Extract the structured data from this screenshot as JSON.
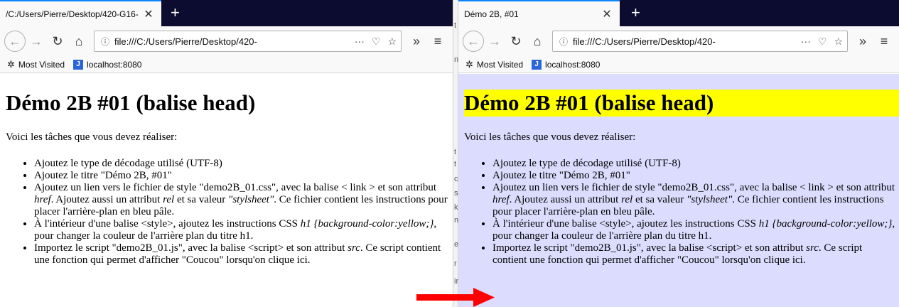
{
  "left_window": {
    "tab": {
      "title": "/C:/Users/Pierre/Desktop/420-G16-",
      "close_label": "✕",
      "new_tab_label": "+"
    },
    "url": "file:///C:/Users/Pierre/Desktop/420-",
    "bookmarks": [
      {
        "label": "Most Visited",
        "icon": "gear-icon"
      },
      {
        "label": "localhost:8080",
        "icon": "jetbrains-icon"
      }
    ],
    "page": {
      "heading": "Démo 2B #01 (balise head)",
      "intro": "Voici les tâches que vous devez réaliser:",
      "items": [
        "Ajoutez le type de décodage utilisé (UTF-8)",
        "Ajoutez le titre \"Démo 2B, #01\"",
        "Ajoutez un lien vers le fichier de style \"demo2B_01.css\", avec la balise < link > et son attribut href. Ajoutez aussi un attribut rel et sa valeur \"stylsheet\". Ce fichier contient les instructions pour placer l'arrière-plan en bleu pâle.",
        "À l'intérieur d'une balise <style>, ajoutez les instructions CSS h1 {background-color:yellow;}, pour changer la couleur de l'arrière plan du titre h1.",
        "Importez le script \"demo2B_01.js\", avec la balise <script> et son attribut src. Ce script contient une fonction qui permet d'afficher \"Coucou\" lorsqu'on clique ici."
      ]
    }
  },
  "right_window": {
    "tab": {
      "title": "Démo 2B, #01",
      "close_label": "✕",
      "new_tab_label": "+"
    },
    "url": "file:///C:/Users/Pierre/Desktop/420-",
    "bookmarks": [
      {
        "label": "Most Visited",
        "icon": "gear-icon"
      },
      {
        "label": "localhost:8080",
        "icon": "jetbrains-icon"
      }
    ],
    "page": {
      "heading": "Démo 2B #01 (balise head)",
      "intro": "Voici les tâches que vous devez réaliser:",
      "background": "#dcdcff",
      "heading_background": "#ffff00"
    }
  },
  "between_text": [
    "t",
    "n",
    "t",
    "t",
    "c",
    "s",
    "k",
    "n",
    "e",
    "r",
    "ir"
  ],
  "arrow_color": "#ff0000"
}
